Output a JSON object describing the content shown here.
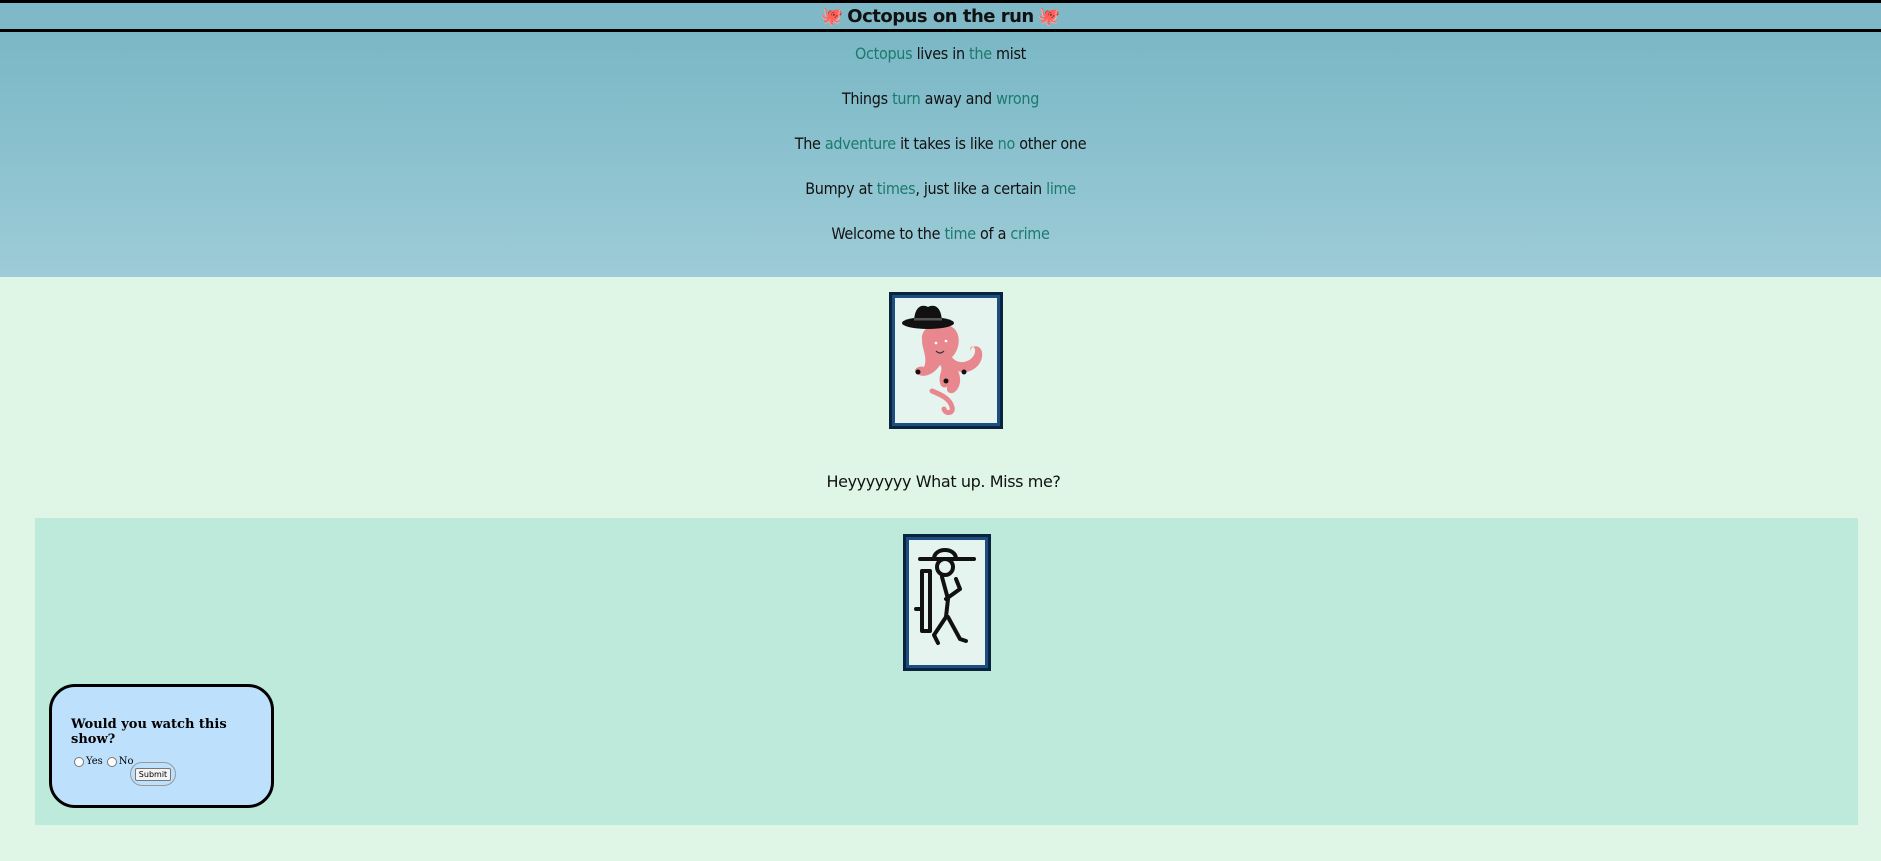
{
  "header": {
    "title": "Octopus on the run",
    "left_icon": "octopus-emoji",
    "right_icon": "octopus-emoji"
  },
  "poem": {
    "lines": [
      [
        {
          "t": "Octopus",
          "hl": true
        },
        {
          "t": " lives in ",
          "hl": false
        },
        {
          "t": "the",
          "hl": true
        },
        {
          "t": " mist",
          "hl": false
        }
      ],
      [
        {
          "t": "Things ",
          "hl": false
        },
        {
          "t": "turn",
          "hl": true
        },
        {
          "t": " away and ",
          "hl": false
        },
        {
          "t": "wrong",
          "hl": true
        }
      ],
      [
        {
          "t": "The ",
          "hl": false
        },
        {
          "t": "adventure",
          "hl": true
        },
        {
          "t": " it takes is like ",
          "hl": false
        },
        {
          "t": "no",
          "hl": true
        },
        {
          "t": " other one",
          "hl": false
        }
      ],
      [
        {
          "t": "Bumpy at ",
          "hl": false
        },
        {
          "t": "times",
          "hl": true
        },
        {
          "t": ", just like a certain ",
          "hl": false
        },
        {
          "t": "lime",
          "hl": true
        }
      ],
      [
        {
          "t": "Welcome to the ",
          "hl": false
        },
        {
          "t": "time",
          "hl": true
        },
        {
          "t": " of a ",
          "hl": false
        },
        {
          "t": "crime",
          "hl": true
        }
      ]
    ]
  },
  "main": {
    "greeting": "Heyyyyyyy What up. Miss me?",
    "octopus_image": "octopus-cowboy-image",
    "hiker_image": "hiker-image"
  },
  "poll": {
    "question": "Would you watch this show?",
    "options": [
      "Yes",
      "No"
    ],
    "submit_label": "Submit"
  },
  "colors": {
    "header_bg": "#7fb8c6",
    "highlight": "#1c7a6c",
    "content_bg": "#dff5e6",
    "inner_bg": "#bdeadb",
    "poll_bg": "#bde0fc"
  }
}
